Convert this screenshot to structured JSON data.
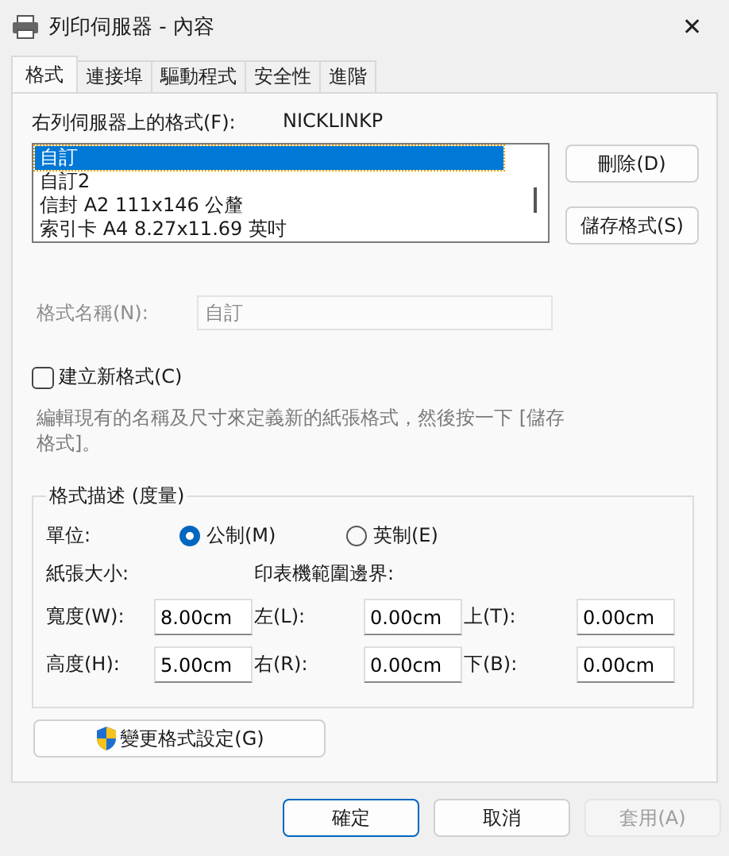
{
  "window": {
    "title": "列印伺服器 - 內容",
    "close": "✕"
  },
  "tabs": [
    {
      "label": "格式",
      "selected": true
    },
    {
      "label": "連接埠",
      "selected": false
    },
    {
      "label": "驅動程式",
      "selected": false
    },
    {
      "label": "安全性",
      "selected": false
    },
    {
      "label": "進階",
      "selected": false
    }
  ],
  "forms_label": "右列伺服器上的格式(F):",
  "server_name": "NICKLINKP",
  "forms": [
    {
      "label": "自訂",
      "selected": true
    },
    {
      "label": "自訂2",
      "selected": false
    },
    {
      "label": "信封 A2 111x146 公釐",
      "selected": false
    },
    {
      "label": "索引卡 A4 8.27x11.69 英吋",
      "selected": false
    }
  ],
  "form_buttons": [
    "刪除(D)",
    "儲存格式(S)"
  ],
  "form_name": {
    "label": "格式名稱(N):",
    "value": "自訂",
    "disabled": true
  },
  "create_new": {
    "label": "建立新格式(C)",
    "checked": false
  },
  "hint": "編輯現有的名稱及尺寸來定義新的紙張格式，然後按一下 [儲存格式]。",
  "description": {
    "title": "格式描述 (度量)",
    "units_label": "單位:",
    "units": [
      {
        "label": "公制(M)",
        "selected": true
      },
      {
        "label": "英制(E)",
        "selected": false
      }
    ],
    "paper_size_label": "紙張大小:",
    "margins_label": "印表機範圍邊界:",
    "rows": [
      [
        {
          "label": "寬度(W):",
          "value": "8.00cm"
        },
        {
          "label": "左(L):",
          "value": "0.00cm"
        },
        {
          "label": "上(T):",
          "value": "0.00cm"
        }
      ],
      [
        {
          "label": "高度(H):",
          "value": "5.00cm"
        },
        {
          "label": "右(R):",
          "value": "0.00cm"
        },
        {
          "label": "下(B):",
          "value": "0.00cm"
        }
      ]
    ]
  },
  "change_button": "變更格式設定(G)",
  "buttons": [
    {
      "label": "確定",
      "kind": "default",
      "disabled": false
    },
    {
      "label": "取消",
      "kind": "normal",
      "disabled": false
    },
    {
      "label": "套用(A)",
      "kind": "normal",
      "disabled": true
    }
  ]
}
